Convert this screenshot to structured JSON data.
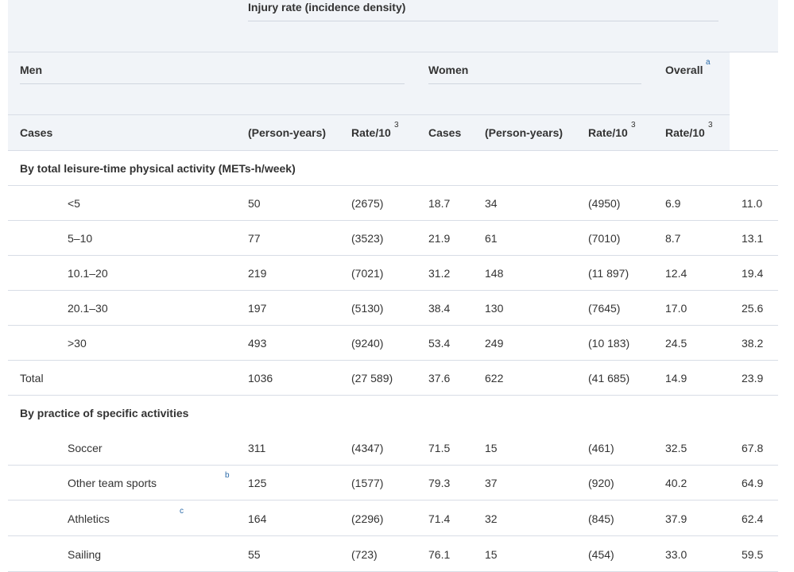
{
  "header": {
    "injury_rate": "Injury rate (incidence density)",
    "men": "Men",
    "women": "Women",
    "overall": "Overall",
    "overall_note": "a"
  },
  "columns": {
    "cases_1": "Cases",
    "py_1": "(Person-years)",
    "rate_1": "Rate/10",
    "rate_1_exp": "3",
    "cases_2": "Cases",
    "py_2": "(Person-years)",
    "rate_2": "Rate/10",
    "rate_2_exp": "3",
    "rate_3": "Rate/10",
    "rate_3_exp": "3"
  },
  "sections": {
    "leisure": "By total leisure-time physical activity (METs-h/week)",
    "specific": "By practice of specific activities"
  },
  "rows": [
    {
      "label": "<5",
      "note": "",
      "c1": "50",
      "c2": "(2675)",
      "c3": "18.7",
      "c4": "34",
      "c5": "(4950)",
      "c6": "6.9",
      "c7": "11.0"
    },
    {
      "label": "5–10",
      "note": "",
      "c1": "77",
      "c2": "(3523)",
      "c3": "21.9",
      "c4": "61",
      "c5": "(7010)",
      "c6": "8.7",
      "c7": "13.1"
    },
    {
      "label": "10.1–20",
      "note": "",
      "c1": "219",
      "c2": "(7021)",
      "c3": "31.2",
      "c4": "148",
      "c5": "(11 897)",
      "c6": "12.4",
      "c7": "19.4"
    },
    {
      "label": "20.1–30",
      "note": "",
      "c1": "197",
      "c2": "(5130)",
      "c3": "38.4",
      "c4": "130",
      "c5": "(7645)",
      "c6": "17.0",
      "c7": "25.6"
    },
    {
      "label": ">30",
      "note": "",
      "c1": "493",
      "c2": "(9240)",
      "c3": "53.4",
      "c4": "249",
      "c5": "(10 183)",
      "c6": "24.5",
      "c7": "38.2"
    },
    {
      "label": "Total",
      "note": "",
      "c1": "1036",
      "c2": "(27 589)",
      "c3": "37.6",
      "c4": "622",
      "c5": "(41 685)",
      "c6": "14.9",
      "c7": "23.9"
    },
    {
      "label": "Soccer",
      "note": "",
      "c1": "311",
      "c2": "(4347)",
      "c3": "71.5",
      "c4": "15",
      "c5": "(461)",
      "c6": "32.5",
      "c7": "67.8"
    },
    {
      "label": "Other team sports",
      "note": "b",
      "c1": "125",
      "c2": "(1577)",
      "c3": "79.3",
      "c4": "37",
      "c5": "(920)",
      "c6": "40.2",
      "c7": "64.9"
    },
    {
      "label": "Athletics",
      "note": "c",
      "c1": "164",
      "c2": "(2296)",
      "c3": "71.4",
      "c4": "32",
      "c5": "(845)",
      "c6": "37.9",
      "c7": "62.4"
    },
    {
      "label": "Sailing",
      "note": "",
      "c1": "55",
      "c2": "(723)",
      "c3": "76.1",
      "c4": "15",
      "c5": "(454)",
      "c6": "33.0",
      "c7": "59.5"
    }
  ]
}
